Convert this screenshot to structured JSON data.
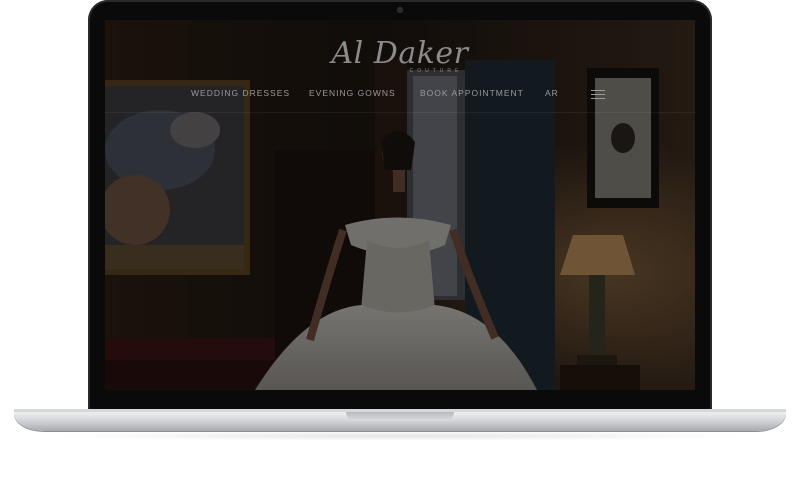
{
  "site": {
    "logo_script": "Al Daker",
    "logo_sub": "COUTURE"
  },
  "nav": {
    "items": [
      {
        "label": "WEDDING DRESSES"
      },
      {
        "label": "EVENING GOWNS"
      },
      {
        "label": "BOOK APPOINTMENT"
      },
      {
        "label": "AR"
      }
    ],
    "menu_icon": "hamburger-menu-icon"
  },
  "colors": {
    "nav_text": "#9a9a9a",
    "logo": "#8b8b8b",
    "bezel": "#0a0a0a",
    "chassis": "#c9cace"
  }
}
